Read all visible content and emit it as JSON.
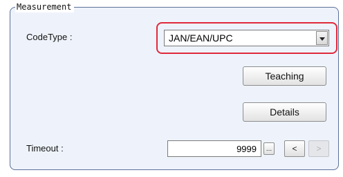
{
  "group": {
    "title": "Measurement"
  },
  "codetype": {
    "label": "CodeType :",
    "value": "JAN/EAN/UPC"
  },
  "buttons": {
    "teaching": "Teaching",
    "details": "Details"
  },
  "timeout": {
    "label": "Timeout :",
    "value": "9999",
    "ellipsis": "...",
    "decrement": "<",
    "increment": ">"
  },
  "colors": {
    "highlight": "#e0283a",
    "panel_bg": "#eef3fb",
    "panel_border": "#5a6f97"
  }
}
